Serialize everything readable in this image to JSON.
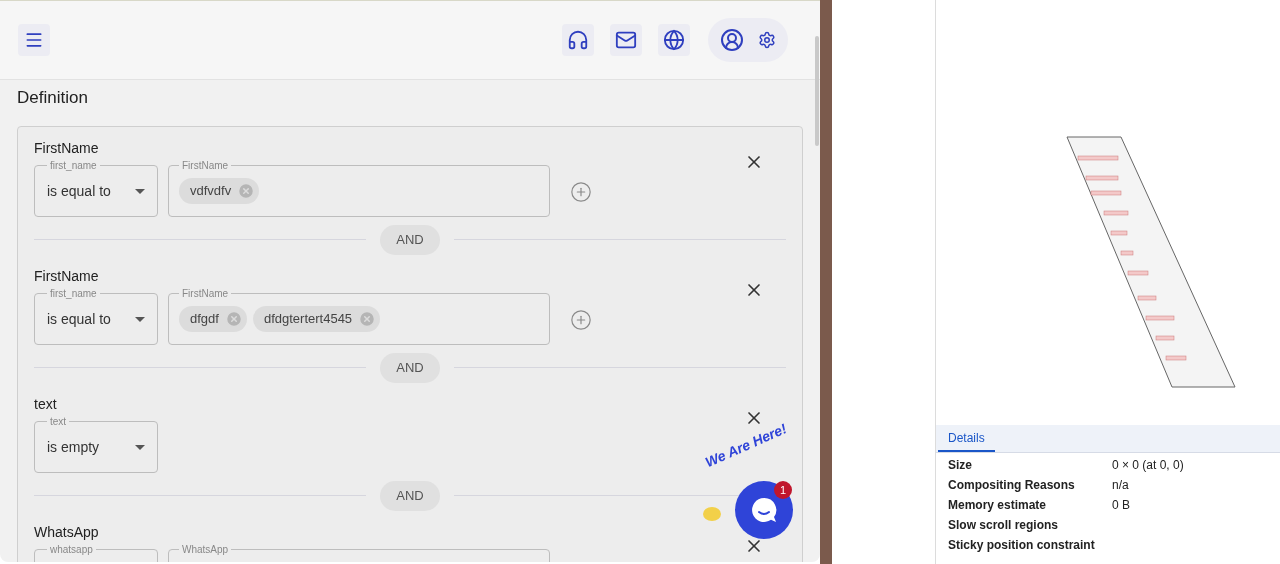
{
  "section_title": "Definition",
  "conditions": [
    {
      "kind": "values",
      "field": "FirstName",
      "operator_label": "first_name",
      "operator": "is equal to",
      "values_label": "FirstName",
      "values": [
        "vdfvdfv"
      ],
      "connector": "AND"
    },
    {
      "kind": "values",
      "field": "FirstName",
      "operator_label": "first_name",
      "operator": "is equal to",
      "values_label": "FirstName",
      "values": [
        "dfgdf",
        "dfdgtertert4545"
      ],
      "connector": "AND"
    },
    {
      "kind": "operator_only",
      "field": "text",
      "operator_label": "text",
      "operator": "is empty",
      "connector": "AND"
    },
    {
      "kind": "values",
      "field": "WhatsApp",
      "operator_label": "whatsapp",
      "values_label": "WhatsApp"
    }
  ],
  "chat": {
    "caption": "We Are Here!",
    "badge": "1"
  },
  "devtools": {
    "tabs": [
      {
        "label": "Details",
        "selected": true
      }
    ],
    "details": [
      {
        "label": "Size",
        "value": "0 × 0 (at 0, 0)"
      },
      {
        "label": "Compositing Reasons",
        "value": "n/a"
      },
      {
        "label": "Memory estimate",
        "value": "0 B"
      },
      {
        "label": "Slow scroll regions"
      },
      {
        "label": "Sticky position constraint"
      }
    ]
  }
}
